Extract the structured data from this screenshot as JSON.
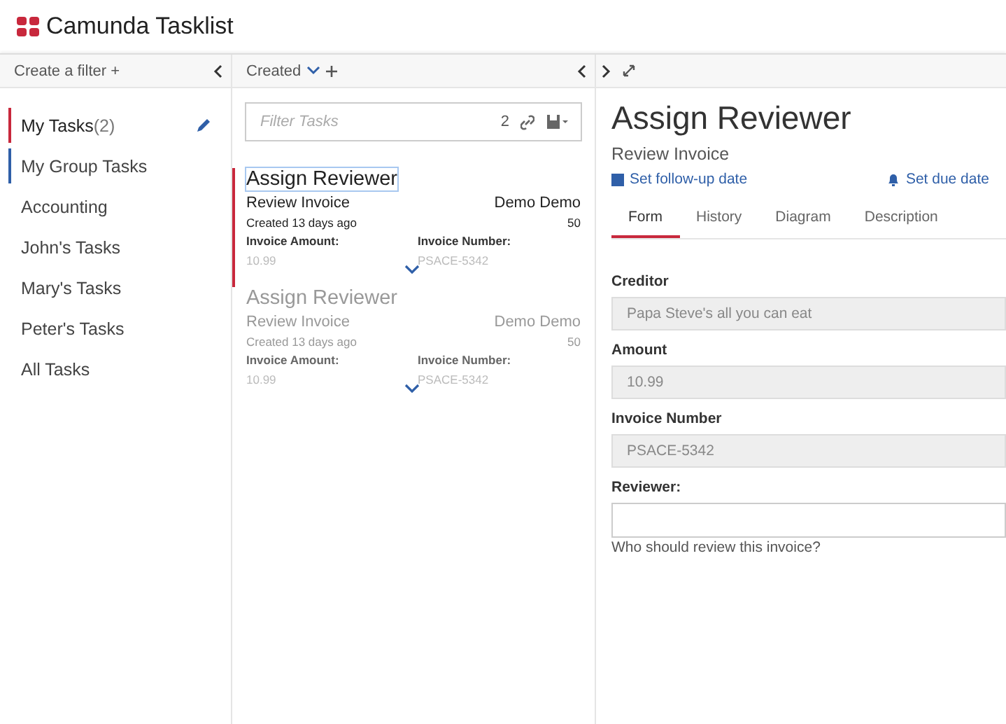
{
  "app": {
    "title": "Camunda Tasklist"
  },
  "filters_panel": {
    "create_label": "Create a filter +",
    "items": [
      {
        "label": "My Tasks",
        "count": "(2)",
        "selected": true,
        "color": "#c8283c",
        "editable": true
      },
      {
        "label": "My Group Tasks",
        "selected": false,
        "color": "#2f5fa8",
        "editable": false
      },
      {
        "label": "Accounting",
        "selected": false,
        "editable": false
      },
      {
        "label": "John's Tasks",
        "selected": false,
        "editable": false
      },
      {
        "label": "Mary's Tasks",
        "selected": false,
        "editable": false
      },
      {
        "label": "Peter's Tasks",
        "selected": false,
        "editable": false
      },
      {
        "label": "All Tasks",
        "selected": false,
        "editable": false
      }
    ]
  },
  "task_list": {
    "sort_label": "Created",
    "search": {
      "placeholder": "Filter Tasks",
      "count": "2"
    },
    "tasks": [
      {
        "name": "Assign Reviewer",
        "process": "Review Invoice",
        "assignee": "Demo Demo",
        "created": "Created 13 days ago",
        "priority": "50",
        "var_labels": [
          "Invoice Amount:",
          "Invoice Number:"
        ],
        "var_values": [
          "10.99",
          "PSACE-5342"
        ],
        "selected": true
      },
      {
        "name": "Assign Reviewer",
        "process": "Review Invoice",
        "assignee": "Demo Demo",
        "created": "Created 13 days ago",
        "priority": "50",
        "var_labels": [
          "Invoice Amount:",
          "Invoice Number:"
        ],
        "var_values": [
          "10.99",
          "PSACE-5342"
        ],
        "selected": false
      }
    ]
  },
  "task_detail": {
    "title": "Assign Reviewer",
    "subtitle": "Review Invoice",
    "follow_up": "Set follow-up date",
    "due": "Set due date",
    "tabs": [
      {
        "label": "Form",
        "selected": true
      },
      {
        "label": "History",
        "selected": false
      },
      {
        "label": "Diagram",
        "selected": false
      },
      {
        "label": "Description",
        "selected": false
      }
    ],
    "form": [
      {
        "label": "Creditor",
        "value": "Papa Steve's all you can eat",
        "kind": "readonly"
      },
      {
        "label": "Amount",
        "value": "10.99",
        "kind": "readonly"
      },
      {
        "label": "Invoice Number",
        "value": "PSACE-5342",
        "kind": "readonly"
      },
      {
        "label": "Reviewer:",
        "kind": "input",
        "help": "Who should review this invoice?"
      }
    ]
  }
}
